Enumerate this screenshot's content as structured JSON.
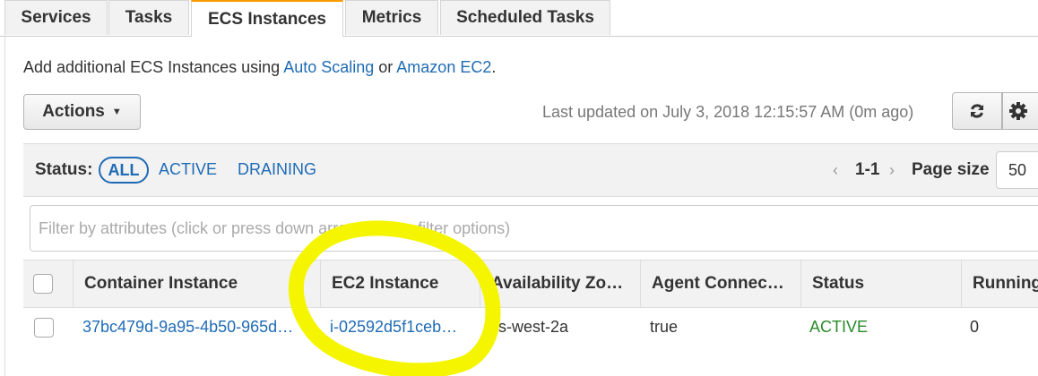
{
  "tabs": [
    {
      "label": "Services",
      "active": false
    },
    {
      "label": "Tasks",
      "active": false
    },
    {
      "label": "ECS Instances",
      "active": true
    },
    {
      "label": "Metrics",
      "active": false
    },
    {
      "label": "Scheduled Tasks",
      "active": false
    }
  ],
  "info": {
    "prefix": "Add additional ECS Instances using ",
    "link1": "Auto Scaling",
    "middle": " or ",
    "link2": "Amazon EC2",
    "suffix": "."
  },
  "toolbar": {
    "actions_label": "Actions",
    "last_updated": "Last updated on July 3, 2018 12:15:57 AM (0m ago)"
  },
  "status_filter": {
    "label": "Status:",
    "options": [
      "ALL",
      "ACTIVE",
      "DRAINING"
    ],
    "selected": "ALL"
  },
  "pagination": {
    "range": "1-1",
    "page_size_label": "Page size",
    "page_size": "50"
  },
  "filter": {
    "placeholder": "Filter by attributes (click or press down arrow to view filter options)"
  },
  "table": {
    "columns": [
      "Container Instance",
      "EC2 Instance",
      "Availability Zo…",
      "Agent Connec…",
      "Status",
      "Running"
    ],
    "rows": [
      {
        "container_instance": "37bc479d-9a95-4b50-965d…",
        "ec2_instance": "i-02592d5f1ceb…",
        "availability_zone": "us-west-2a",
        "agent_connected": "true",
        "status": "ACTIVE",
        "running": "0"
      }
    ]
  },
  "colors": {
    "link": "#1f6bb5",
    "active_status": "#2a8b2a",
    "highlight": "#f5f500",
    "tab_accent": "#ff9900"
  },
  "icons": [
    "caret-down-icon",
    "refresh-icon",
    "gear-icon",
    "chevron-left-icon",
    "chevron-right-icon"
  ]
}
